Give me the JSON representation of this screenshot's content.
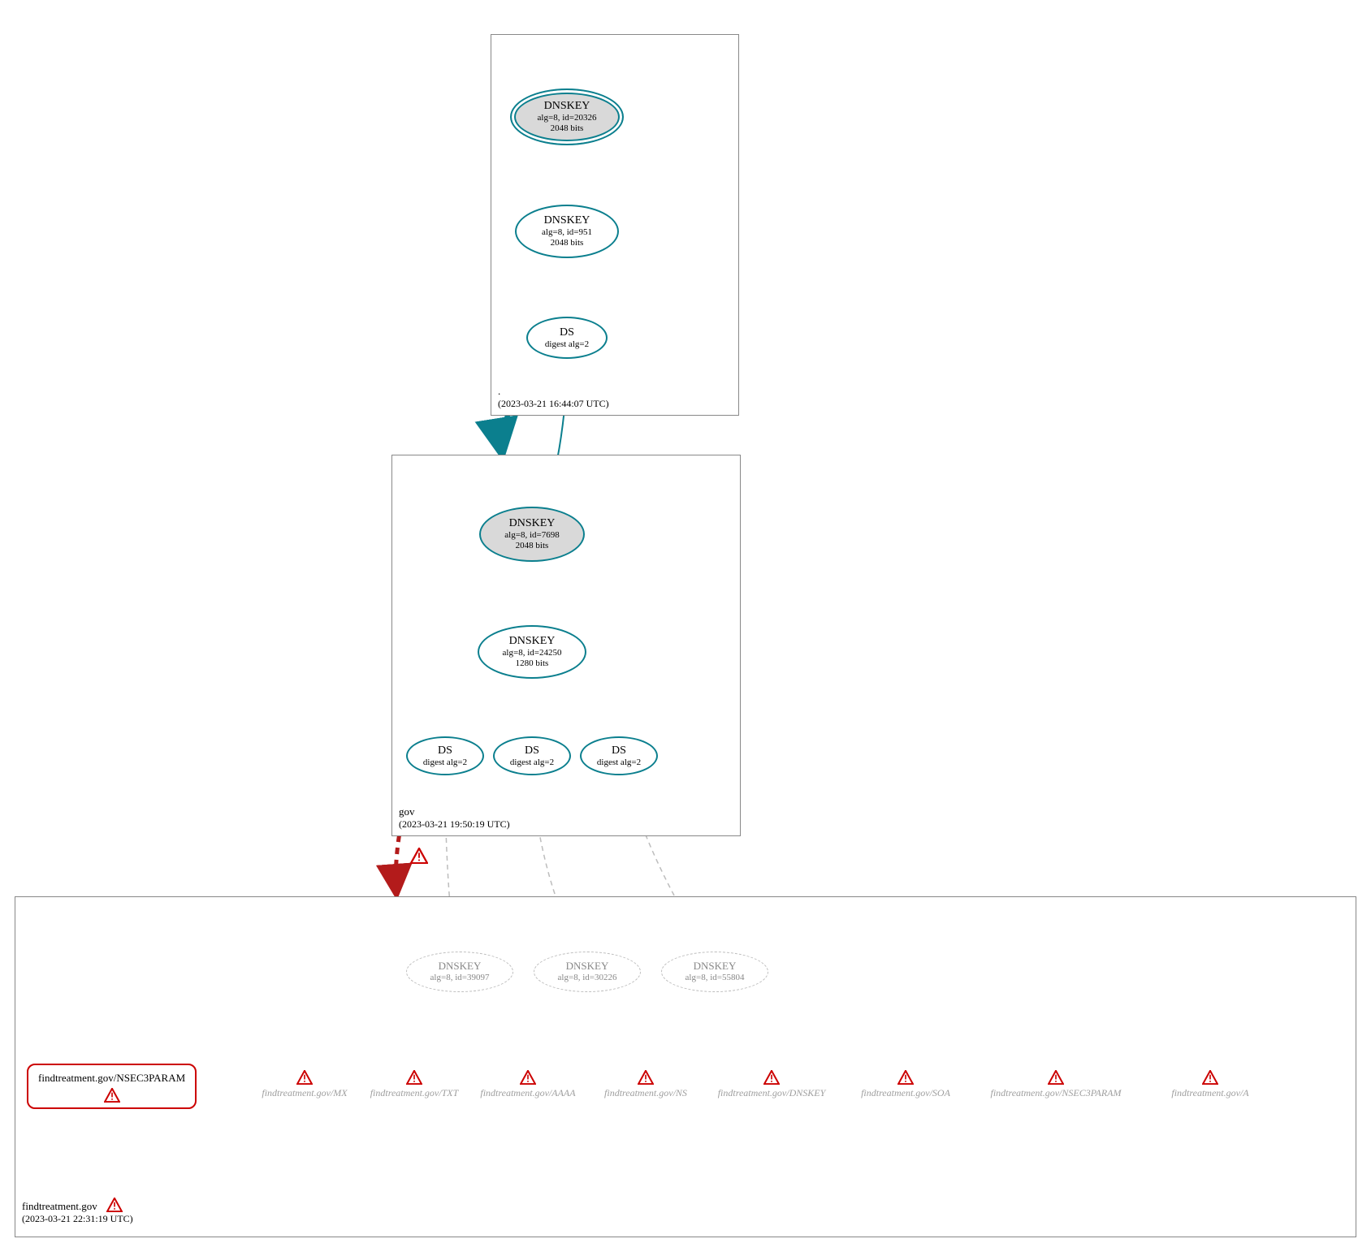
{
  "colors": {
    "teal": "#0b7f8e",
    "red": "#cc0000",
    "gray_dashed": "#bdbdbd",
    "gray_text": "#9e9e9e",
    "fill_gray": "#d9d9d9"
  },
  "zones": {
    "root": {
      "name": ".",
      "timestamp": "(2023-03-21 16:44:07 UTC)",
      "nodes": {
        "ksk": {
          "title": "DNSKEY",
          "line1": "alg=8, id=20326",
          "line2": "2048 bits"
        },
        "zsk": {
          "title": "DNSKEY",
          "line1": "alg=8, id=951",
          "line2": "2048 bits"
        },
        "ds": {
          "title": "DS",
          "line1": "digest alg=2"
        }
      }
    },
    "gov": {
      "name": "gov",
      "timestamp": "(2023-03-21 19:50:19 UTC)",
      "nodes": {
        "ksk": {
          "title": "DNSKEY",
          "line1": "alg=8, id=7698",
          "line2": "2048 bits"
        },
        "zsk": {
          "title": "DNSKEY",
          "line1": "alg=8, id=24250",
          "line2": "1280 bits"
        },
        "ds1": {
          "title": "DS",
          "line1": "digest alg=2"
        },
        "ds2": {
          "title": "DS",
          "line1": "digest alg=2"
        },
        "ds3": {
          "title": "DS",
          "line1": "digest alg=2"
        }
      }
    },
    "findtreatment": {
      "name": "findtreatment.gov",
      "timestamp": "(2023-03-21 22:31:19 UTC)",
      "dnskeys": {
        "k1": {
          "title": "DNSKEY",
          "line1": "alg=8, id=39097"
        },
        "k2": {
          "title": "DNSKEY",
          "line1": "alg=8, id=30226"
        },
        "k3": {
          "title": "DNSKEY",
          "line1": "alg=8, id=55804"
        }
      },
      "error_box": {
        "label": "findtreatment.gov/NSEC3PARAM"
      },
      "rrsets": [
        "findtreatment.gov/MX",
        "findtreatment.gov/TXT",
        "findtreatment.gov/AAAA",
        "findtreatment.gov/NS",
        "findtreatment.gov/DNSKEY",
        "findtreatment.gov/SOA",
        "findtreatment.gov/NSEC3PARAM",
        "findtreatment.gov/A"
      ]
    }
  }
}
